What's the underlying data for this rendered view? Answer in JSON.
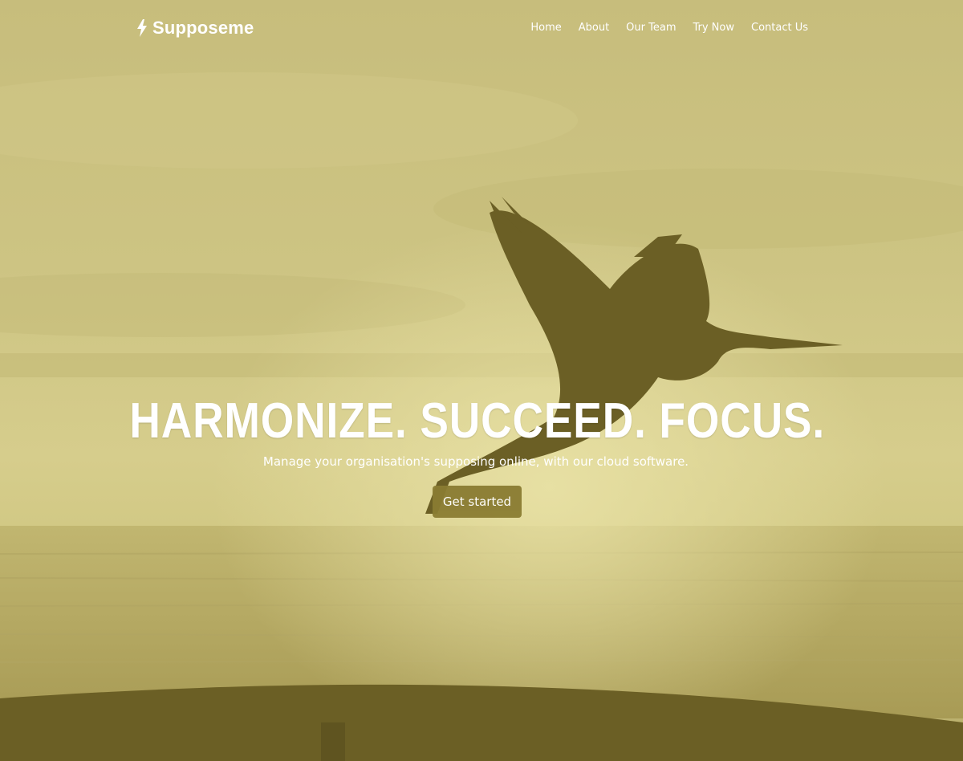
{
  "brand": {
    "name": "Supposeme",
    "icon": "bolt-icon"
  },
  "nav": {
    "items": [
      {
        "label": "Home"
      },
      {
        "label": "About"
      },
      {
        "label": "Our Team"
      },
      {
        "label": "Try Now"
      },
      {
        "label": "Contact Us"
      }
    ]
  },
  "hero": {
    "headline": "HARMONIZE. SUCCEED. FOCUS.",
    "subheadline": "Manage your organisation's supposing online, with our cloud software.",
    "cta_label": "Get started",
    "background": "heron-flying-over-sea-photo"
  },
  "colors": {
    "overlay": "#c9c07a",
    "shadow": "#6b5f25",
    "button": "#8a7c32",
    "text": "#ffffff"
  }
}
